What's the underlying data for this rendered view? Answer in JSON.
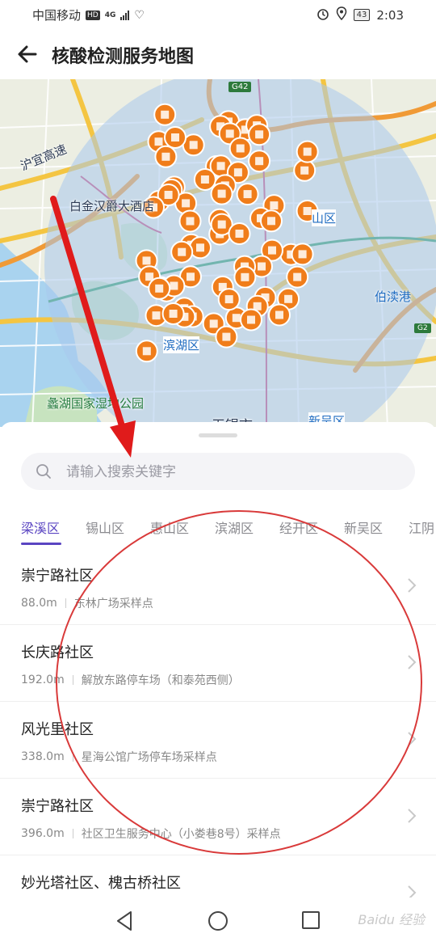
{
  "status_bar": {
    "carrier": "中国移动",
    "hd_badge": "HD",
    "network": "4G",
    "battery": "43",
    "time": "2:03"
  },
  "header": {
    "title": "核酸检测服务地图"
  },
  "map": {
    "labels": {
      "expressway": "沪宜高速",
      "hotel": "白金汉爵大酒店",
      "district_shan": "山区",
      "bodu": "伯渎港",
      "binhu": "滨湖区",
      "wetland": "蠡湖国家湿地公园",
      "city": "无锡市",
      "xinwu": "新吴区",
      "g42": "G42",
      "g2": "G2"
    },
    "site_marker_count": 70,
    "colors": {
      "marker": "#f07d1a",
      "radius_fill": "#aac8ec",
      "road": "#f4c542",
      "arrow": "#e01b1b"
    }
  },
  "search": {
    "placeholder": "请输入搜索关键字"
  },
  "tabs": [
    {
      "label": "梁溪区",
      "active": true
    },
    {
      "label": "锡山区",
      "active": false
    },
    {
      "label": "惠山区",
      "active": false
    },
    {
      "label": "滨湖区",
      "active": false
    },
    {
      "label": "经开区",
      "active": false
    },
    {
      "label": "新吴区",
      "active": false
    },
    {
      "label": "江阴",
      "active": false
    }
  ],
  "sites": [
    {
      "name": "崇宁路社区",
      "distance": "88.0m",
      "place": "东林广场采样点"
    },
    {
      "name": "长庆路社区",
      "distance": "192.0m",
      "place": "解放东路停车场（和泰苑西侧）"
    },
    {
      "name": "风光里社区",
      "distance": "338.0m",
      "place": "星海公馆广场停车场采样点"
    },
    {
      "name": "崇宁路社区",
      "distance": "396.0m",
      "place": "社区卫生服务中心（小娄巷8号）采样点"
    },
    {
      "name": "妙光塔社区、槐古桥社区",
      "distance": "",
      "place": ""
    }
  ],
  "watermark": "Baidu 经验"
}
